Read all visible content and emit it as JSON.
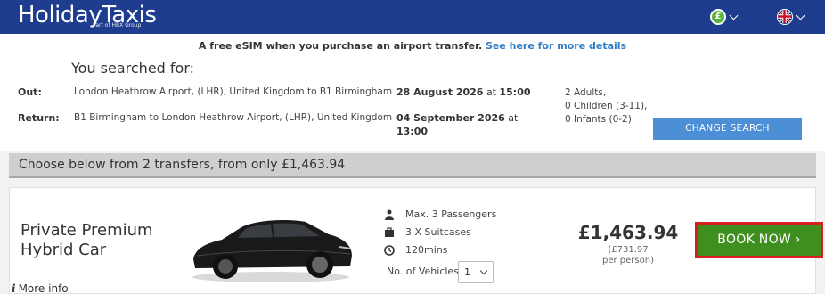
{
  "header": {
    "logo": "HolidayTaxis",
    "logo_sub": "Part of HBX Group",
    "currency_symbol": "£"
  },
  "promo": {
    "text": "A free eSIM when you purchase an airport transfer.",
    "link": "See here for more details"
  },
  "search": {
    "heading": "You searched for:",
    "out": {
      "label": "Out:",
      "route": "London Heathrow Airport, (LHR), United Kingdom to B1 Birmingham",
      "date": "28 August 2026",
      "at": "at",
      "time": "15:00"
    },
    "return": {
      "label": "Return:",
      "route": "B1 Birmingham to London Heathrow Airport, (LHR), United Kingdom",
      "date": "04 September 2026",
      "at": "at",
      "time": "13:00"
    },
    "passengers": [
      "2 Adults,",
      "0 Children (3-11),",
      "0 Infants (0-2)"
    ],
    "change_button": "CHANGE SEARCH"
  },
  "results": {
    "summary": "Choose below from 2 transfers, from only £1,463.94"
  },
  "transfer": {
    "name_line1": "Private Premium",
    "name_line2": "Hybrid Car",
    "more_info": "More info",
    "features": [
      "Max. 3 Passengers",
      "3 X Suitcases",
      "120mins"
    ],
    "vehicles_label": "No. of Vehicles",
    "vehicles_value": "1",
    "price": "£1,463.94",
    "per_person_amount": "(£731.97",
    "per_person_label": "per person)",
    "book_button": "BOOK NOW ›"
  },
  "colors": {
    "header": "#1f3d8f",
    "link": "#2e7dc4",
    "change_button": "#4d8fd6",
    "book_button": "#3f8f1f",
    "book_highlight": "#d81e1e"
  }
}
